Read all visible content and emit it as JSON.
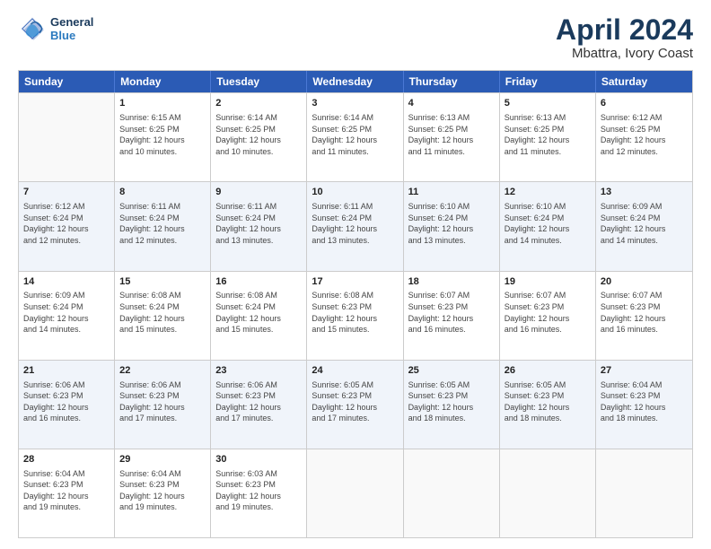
{
  "logo": {
    "line1": "General",
    "line2": "Blue"
  },
  "title": "April 2024",
  "subtitle": "Mbattra, Ivory Coast",
  "header_days": [
    "Sunday",
    "Monday",
    "Tuesday",
    "Wednesday",
    "Thursday",
    "Friday",
    "Saturday"
  ],
  "weeks": [
    [
      {
        "day": "",
        "info": ""
      },
      {
        "day": "1",
        "info": "Sunrise: 6:15 AM\nSunset: 6:25 PM\nDaylight: 12 hours\nand 10 minutes."
      },
      {
        "day": "2",
        "info": "Sunrise: 6:14 AM\nSunset: 6:25 PM\nDaylight: 12 hours\nand 10 minutes."
      },
      {
        "day": "3",
        "info": "Sunrise: 6:14 AM\nSunset: 6:25 PM\nDaylight: 12 hours\nand 11 minutes."
      },
      {
        "day": "4",
        "info": "Sunrise: 6:13 AM\nSunset: 6:25 PM\nDaylight: 12 hours\nand 11 minutes."
      },
      {
        "day": "5",
        "info": "Sunrise: 6:13 AM\nSunset: 6:25 PM\nDaylight: 12 hours\nand 11 minutes."
      },
      {
        "day": "6",
        "info": "Sunrise: 6:12 AM\nSunset: 6:25 PM\nDaylight: 12 hours\nand 12 minutes."
      }
    ],
    [
      {
        "day": "7",
        "info": "Sunrise: 6:12 AM\nSunset: 6:24 PM\nDaylight: 12 hours\nand 12 minutes."
      },
      {
        "day": "8",
        "info": "Sunrise: 6:11 AM\nSunset: 6:24 PM\nDaylight: 12 hours\nand 12 minutes."
      },
      {
        "day": "9",
        "info": "Sunrise: 6:11 AM\nSunset: 6:24 PM\nDaylight: 12 hours\nand 13 minutes."
      },
      {
        "day": "10",
        "info": "Sunrise: 6:11 AM\nSunset: 6:24 PM\nDaylight: 12 hours\nand 13 minutes."
      },
      {
        "day": "11",
        "info": "Sunrise: 6:10 AM\nSunset: 6:24 PM\nDaylight: 12 hours\nand 13 minutes."
      },
      {
        "day": "12",
        "info": "Sunrise: 6:10 AM\nSunset: 6:24 PM\nDaylight: 12 hours\nand 14 minutes."
      },
      {
        "day": "13",
        "info": "Sunrise: 6:09 AM\nSunset: 6:24 PM\nDaylight: 12 hours\nand 14 minutes."
      }
    ],
    [
      {
        "day": "14",
        "info": "Sunrise: 6:09 AM\nSunset: 6:24 PM\nDaylight: 12 hours\nand 14 minutes."
      },
      {
        "day": "15",
        "info": "Sunrise: 6:08 AM\nSunset: 6:24 PM\nDaylight: 12 hours\nand 15 minutes."
      },
      {
        "day": "16",
        "info": "Sunrise: 6:08 AM\nSunset: 6:24 PM\nDaylight: 12 hours\nand 15 minutes."
      },
      {
        "day": "17",
        "info": "Sunrise: 6:08 AM\nSunset: 6:23 PM\nDaylight: 12 hours\nand 15 minutes."
      },
      {
        "day": "18",
        "info": "Sunrise: 6:07 AM\nSunset: 6:23 PM\nDaylight: 12 hours\nand 16 minutes."
      },
      {
        "day": "19",
        "info": "Sunrise: 6:07 AM\nSunset: 6:23 PM\nDaylight: 12 hours\nand 16 minutes."
      },
      {
        "day": "20",
        "info": "Sunrise: 6:07 AM\nSunset: 6:23 PM\nDaylight: 12 hours\nand 16 minutes."
      }
    ],
    [
      {
        "day": "21",
        "info": "Sunrise: 6:06 AM\nSunset: 6:23 PM\nDaylight: 12 hours\nand 16 minutes."
      },
      {
        "day": "22",
        "info": "Sunrise: 6:06 AM\nSunset: 6:23 PM\nDaylight: 12 hours\nand 17 minutes."
      },
      {
        "day": "23",
        "info": "Sunrise: 6:06 AM\nSunset: 6:23 PM\nDaylight: 12 hours\nand 17 minutes."
      },
      {
        "day": "24",
        "info": "Sunrise: 6:05 AM\nSunset: 6:23 PM\nDaylight: 12 hours\nand 17 minutes."
      },
      {
        "day": "25",
        "info": "Sunrise: 6:05 AM\nSunset: 6:23 PM\nDaylight: 12 hours\nand 18 minutes."
      },
      {
        "day": "26",
        "info": "Sunrise: 6:05 AM\nSunset: 6:23 PM\nDaylight: 12 hours\nand 18 minutes."
      },
      {
        "day": "27",
        "info": "Sunrise: 6:04 AM\nSunset: 6:23 PM\nDaylight: 12 hours\nand 18 minutes."
      }
    ],
    [
      {
        "day": "28",
        "info": "Sunrise: 6:04 AM\nSunset: 6:23 PM\nDaylight: 12 hours\nand 19 minutes."
      },
      {
        "day": "29",
        "info": "Sunrise: 6:04 AM\nSunset: 6:23 PM\nDaylight: 12 hours\nand 19 minutes."
      },
      {
        "day": "30",
        "info": "Sunrise: 6:03 AM\nSunset: 6:23 PM\nDaylight: 12 hours\nand 19 minutes."
      },
      {
        "day": "",
        "info": ""
      },
      {
        "day": "",
        "info": ""
      },
      {
        "day": "",
        "info": ""
      },
      {
        "day": "",
        "info": ""
      }
    ]
  ],
  "colors": {
    "header_bg": "#2b5bb5",
    "header_text": "#ffffff",
    "title_color": "#1a3a5c",
    "alt_row_bg": "#e8eef8",
    "cell_border": "#cccccc"
  }
}
